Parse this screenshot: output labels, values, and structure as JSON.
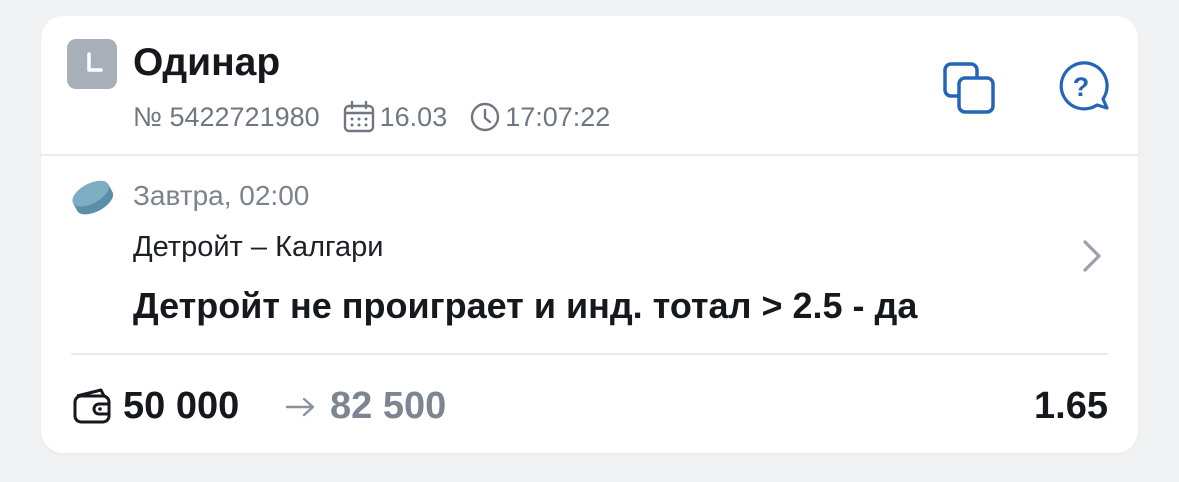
{
  "bet": {
    "type_label": "Одинар",
    "number": "№ 5422721980",
    "date": "16.03",
    "time": "17:07:22",
    "status_icon": "clock-icon",
    "status_color": "#a9afb8"
  },
  "actions": {
    "copy_icon": "copy-icon",
    "help_icon": "help-chat-icon",
    "accent_color": "#2465b8"
  },
  "event": {
    "sport_icon": "hockey-puck-icon",
    "start": "Завтра, 02:00",
    "teams": "Детройт – Калгари",
    "outcome": "Детройт не проиграет и инд. тотал > 2.5 - да"
  },
  "summary": {
    "stake": "50 000",
    "payout": "82 500",
    "odds": "1.65"
  }
}
